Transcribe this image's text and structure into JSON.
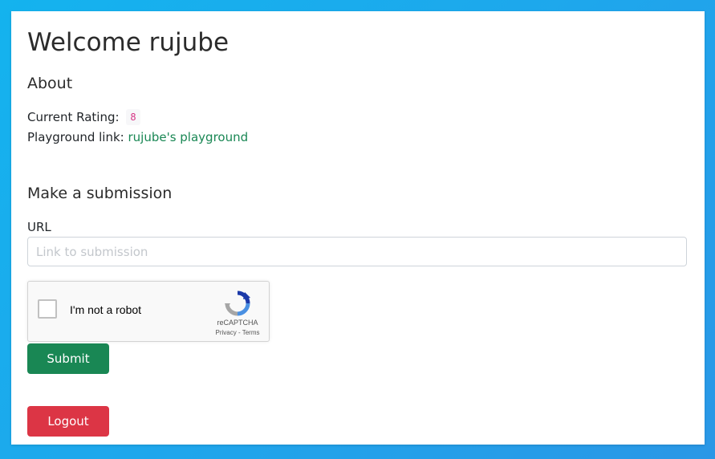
{
  "page": {
    "heading": "Welcome rujube"
  },
  "about": {
    "heading": "About",
    "rating_label": "Current Rating:",
    "rating_value": "8",
    "playground_label": "Playground link:",
    "playground_link_text": "rujube's playground"
  },
  "submission": {
    "heading": "Make a submission",
    "url_label": "URL",
    "url_placeholder": "Link to submission",
    "url_value": ""
  },
  "recaptcha": {
    "checkbox_label": "I'm not a robot",
    "brand": "reCAPTCHA",
    "terms": "Privacy - Terms",
    "checked": false
  },
  "buttons": {
    "submit": "Submit",
    "logout": "Logout"
  },
  "colors": {
    "background": "#1ea7ec",
    "success": "#198754",
    "danger": "#dc3545",
    "badge_text": "#d63384"
  }
}
